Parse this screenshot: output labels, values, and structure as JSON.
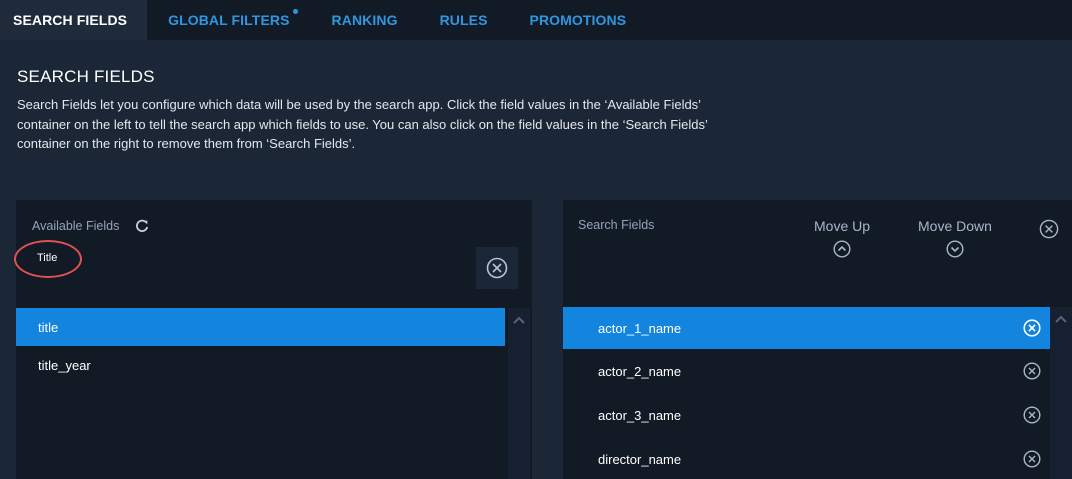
{
  "tabs": [
    {
      "label": "SEARCH FIELDS",
      "active": true
    },
    {
      "label": "GLOBAL FILTERS",
      "has_dot": true
    },
    {
      "label": "RANKING"
    },
    {
      "label": "RULES"
    },
    {
      "label": "PROMOTIONS"
    }
  ],
  "page": {
    "title": "SEARCH FIELDS",
    "description": "Search Fields let you configure which data will be used by the search app. Click the field values in the ‘Available Fields’ container on the left to tell the search app which fields to use. You can also click on the field values in the ‘Search Fields’ container on the right to remove them from ‘Search Fields’."
  },
  "available": {
    "label": "Available Fields",
    "filter_value": "Title",
    "items": [
      {
        "label": "title",
        "selected": true
      },
      {
        "label": "title_year"
      }
    ]
  },
  "search_fields": {
    "label": "Search Fields",
    "move_up_label": "Move Up",
    "move_down_label": "Move Down",
    "items": [
      {
        "label": "actor_1_name",
        "selected": true
      },
      {
        "label": "actor_2_name"
      },
      {
        "label": "actor_3_name"
      },
      {
        "label": "director_name"
      }
    ]
  },
  "colors": {
    "accent": "#1385df",
    "tab_link": "#2f97e0",
    "highlight_ring": "#e05252",
    "background": "#1b2636",
    "panel": "#121a26"
  },
  "icons": [
    "refresh-icon",
    "clear-icon",
    "chevron-up-circle-icon",
    "chevron-down-circle-icon",
    "chevron-up-icon",
    "remove-icon"
  ]
}
